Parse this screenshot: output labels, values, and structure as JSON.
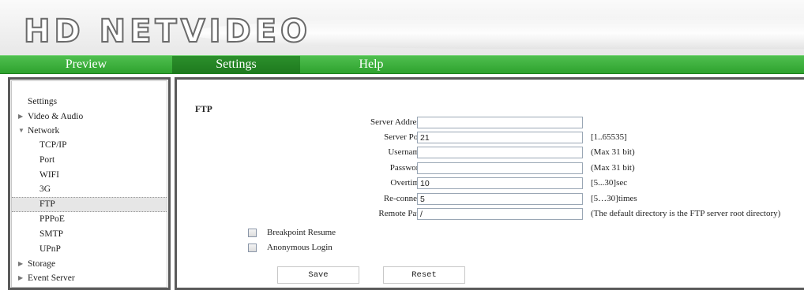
{
  "header": {
    "logo_text": "HD NETVIDEO"
  },
  "nav": {
    "items": [
      {
        "label": "Preview"
      },
      {
        "label": "Settings"
      },
      {
        "label": "Help"
      }
    ]
  },
  "sidebar": {
    "title": "Settings",
    "groups": [
      {
        "label": "Video & Audio",
        "expanded": false
      },
      {
        "label": "Network",
        "expanded": true
      },
      {
        "label": "Storage",
        "expanded": false
      },
      {
        "label": "Event Server",
        "expanded": false
      }
    ],
    "network_items": [
      {
        "label": "TCP/IP"
      },
      {
        "label": "Port"
      },
      {
        "label": "WIFI"
      },
      {
        "label": "3G"
      },
      {
        "label": "FTP",
        "selected": true
      },
      {
        "label": "PPPoE"
      },
      {
        "label": "SMTP"
      },
      {
        "label": "UPnP"
      }
    ]
  },
  "form": {
    "title": "FTP",
    "fields": [
      {
        "label": "Server Address:",
        "value": "",
        "hint": ""
      },
      {
        "label": "Server Port:",
        "value": "21",
        "hint": "[1..65535]"
      },
      {
        "label": "Username:",
        "value": "",
        "hint": "(Max 31 bit)"
      },
      {
        "label": "Password:",
        "value": "",
        "hint": "(Max 31 bit)"
      },
      {
        "label": "Overtime:",
        "value": "10",
        "hint": "[5...30]sec"
      },
      {
        "label": "Re-connect:",
        "value": "5",
        "hint": "[5…30]times"
      },
      {
        "label": "Remote Path:",
        "value": "/",
        "hint": "(The default directory is the FTP server root directory)"
      }
    ],
    "checkboxes": [
      {
        "label": "Breakpoint Resume",
        "checked": false
      },
      {
        "label": "Anonymous Login",
        "checked": false
      }
    ],
    "buttons": {
      "save": "Save",
      "reset": "Reset"
    }
  },
  "colors": {
    "nav_green": "#35a835",
    "nav_active": "#1e7a1e",
    "border_dark": "#5a5a5a"
  }
}
